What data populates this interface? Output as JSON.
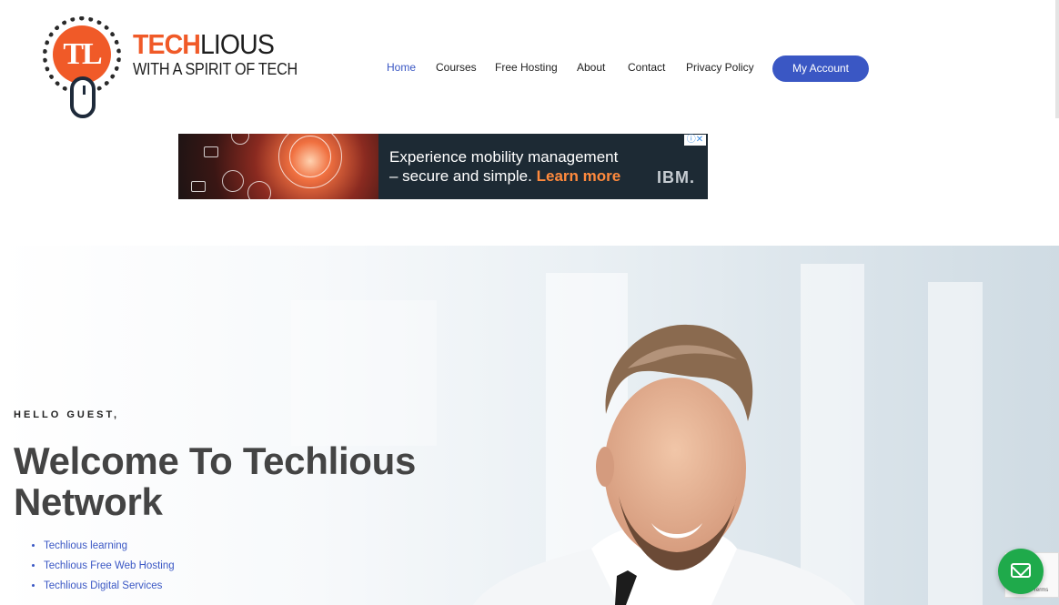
{
  "logo": {
    "monogram": "TL",
    "brand_part1": "TECH",
    "brand_part2": "LIOUS",
    "tagline": "WITH A SPIRIT OF TECH"
  },
  "nav": {
    "items": [
      {
        "label": "Home",
        "active": true
      },
      {
        "label": "Courses"
      },
      {
        "label": "Free Hosting"
      },
      {
        "label": "About"
      },
      {
        "label": "Contact"
      },
      {
        "label": "Privacy Policy"
      }
    ],
    "account_button": "My Account"
  },
  "ad": {
    "line1": "Experience mobility management",
    "line2": "– secure and simple.",
    "cta": "Learn more",
    "advertiser": "IBM.",
    "choices": "ⓘ✕"
  },
  "hero": {
    "eyebrow": "HELLO GUEST,",
    "title": "Welcome To Techlious Network",
    "links": [
      "Techlious learning",
      "Techlious Free Web Hosting",
      "Techlious Digital Services"
    ]
  },
  "recaptcha": {
    "text": "Privacy - Terms"
  },
  "colors": {
    "accent": "#3a57c4",
    "brand": "#f05a28",
    "chat": "#1faa4b"
  }
}
